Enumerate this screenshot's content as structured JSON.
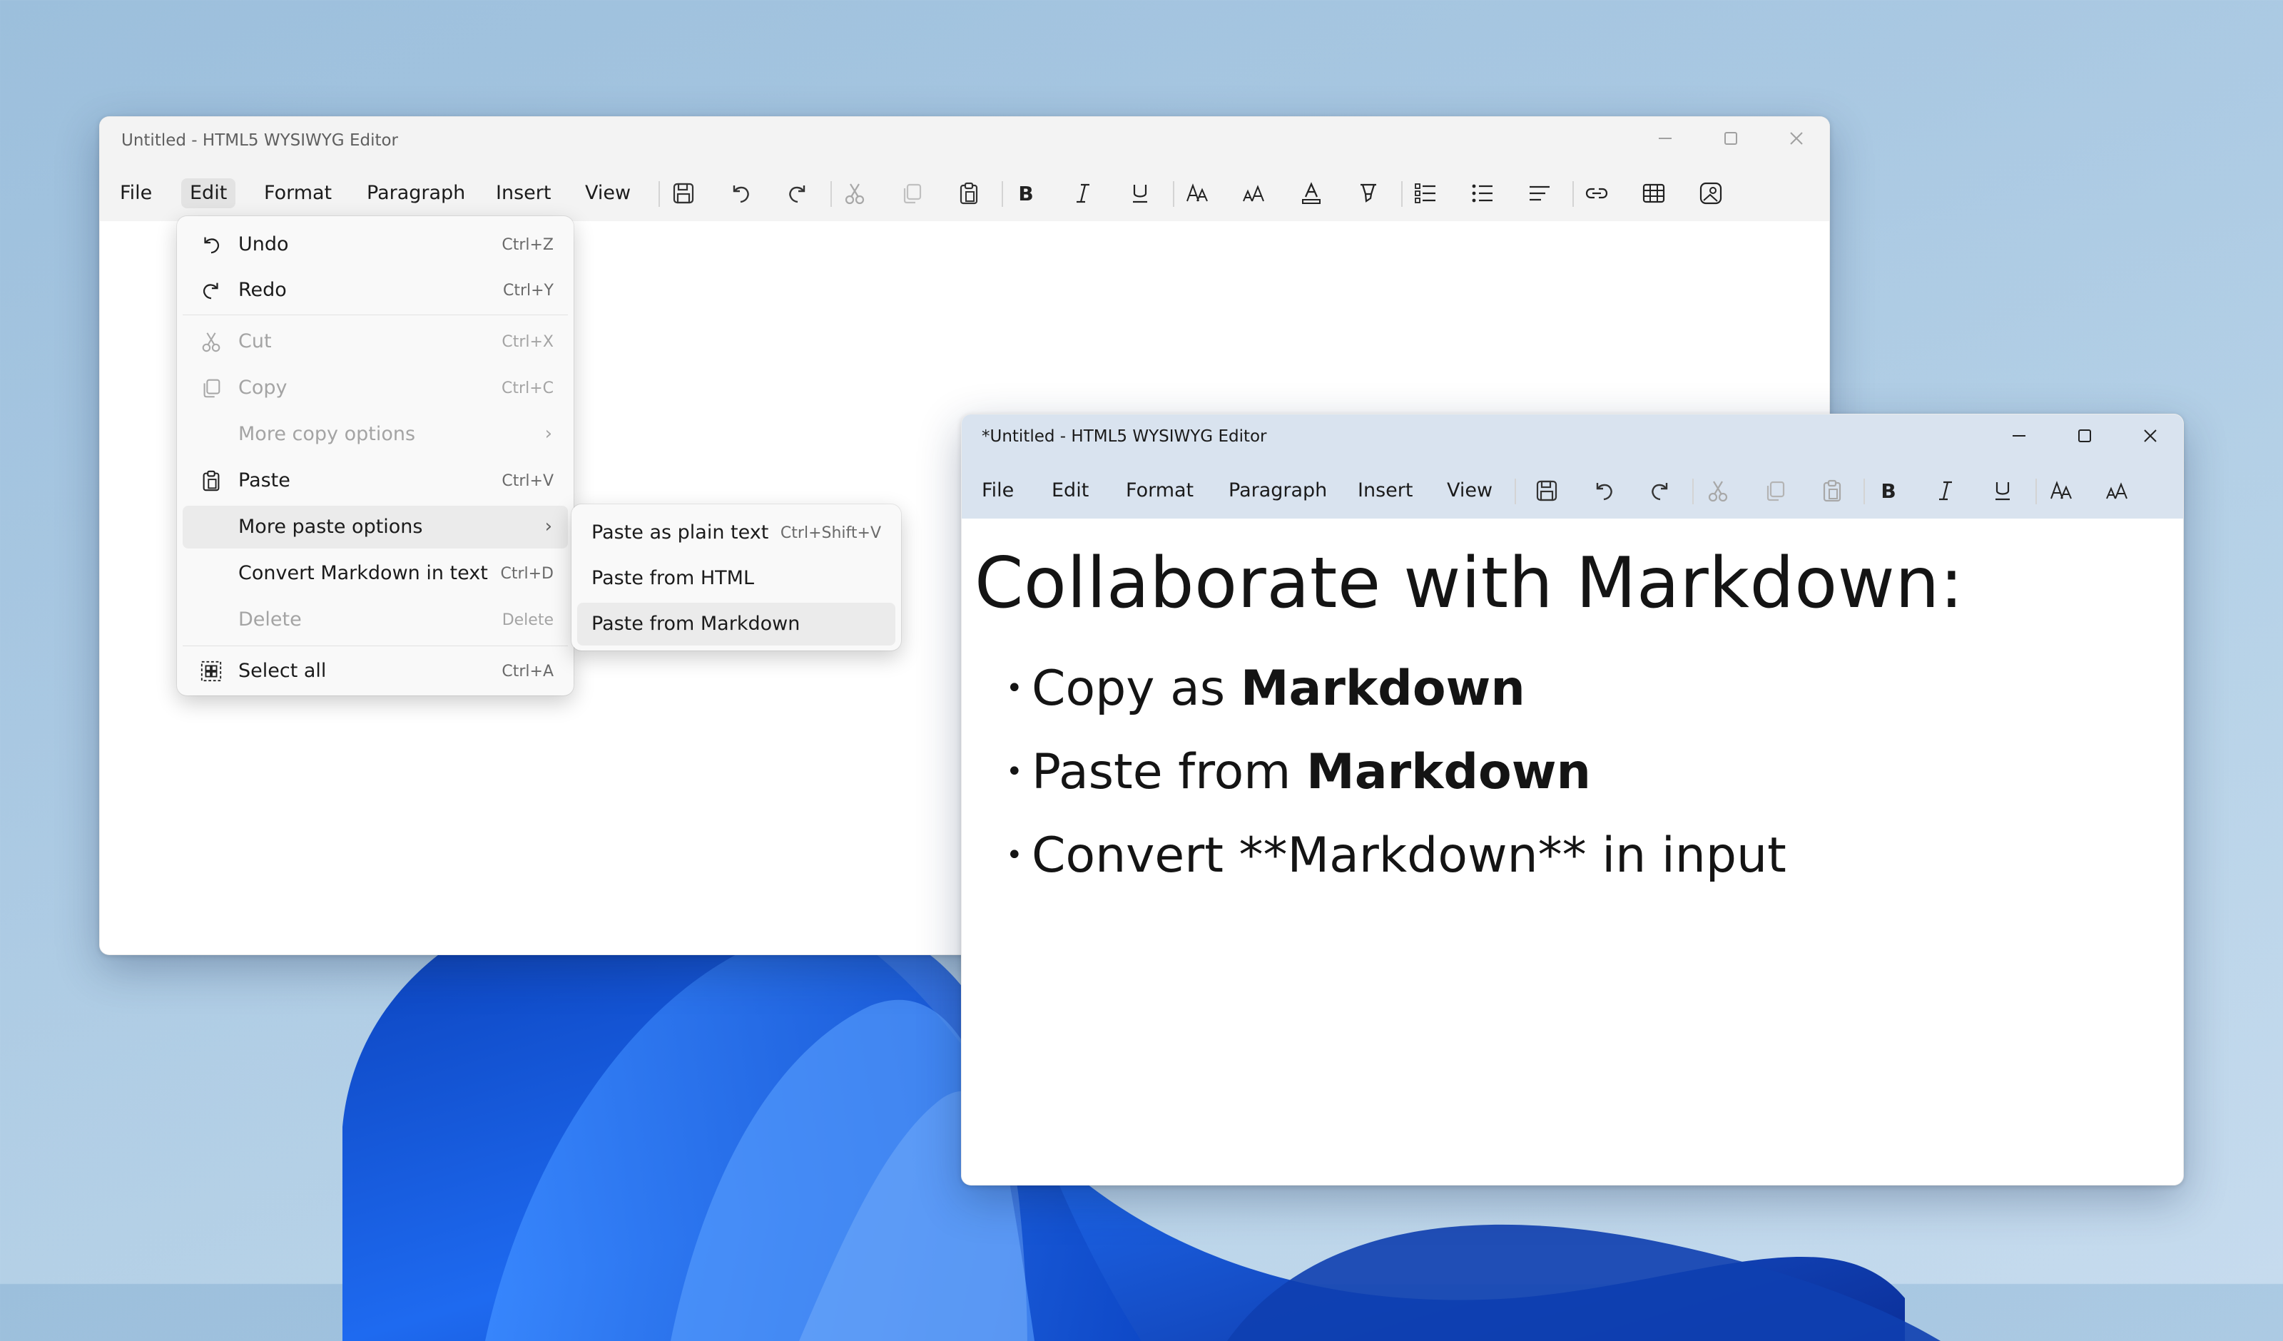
{
  "back_window": {
    "title": "Untitled - HTML5 WYSIWYG Editor",
    "menus": [
      "File",
      "Edit",
      "Format",
      "Paragraph",
      "Insert",
      "View"
    ],
    "active_menu": "Edit"
  },
  "front_window": {
    "title": "*Untitled - HTML5 WYSIWYG Editor",
    "menus": [
      "File",
      "Edit",
      "Format",
      "Paragraph",
      "Insert",
      "View"
    ],
    "document": {
      "heading": "Collaborate with Markdown:",
      "items": [
        {
          "prefix": "Copy as ",
          "bold": "Markdown",
          "suffix": ""
        },
        {
          "prefix": "Paste from ",
          "bold": "Markdown",
          "suffix": ""
        },
        {
          "prefix": "Convert **Markdown** in input",
          "bold": "",
          "suffix": ""
        }
      ]
    }
  },
  "edit_menu": {
    "items": [
      {
        "label": "Undo",
        "shortcut": "Ctrl+Z",
        "icon": "undo-icon",
        "disabled": false
      },
      {
        "label": "Redo",
        "shortcut": "Ctrl+Y",
        "icon": "redo-icon",
        "disabled": false
      },
      {
        "label": "Cut",
        "shortcut": "Ctrl+X",
        "icon": "cut-icon",
        "disabled": true
      },
      {
        "label": "Copy",
        "shortcut": "Ctrl+C",
        "icon": "copy-icon",
        "disabled": true
      },
      {
        "label": "More copy options",
        "shortcut": "",
        "icon": "",
        "disabled": true,
        "submenu": true
      },
      {
        "label": "Paste",
        "shortcut": "Ctrl+V",
        "icon": "paste-icon",
        "disabled": false
      },
      {
        "label": "More paste options",
        "shortcut": "",
        "icon": "",
        "disabled": false,
        "submenu": true,
        "hover": true
      },
      {
        "label": "Convert Markdown in text",
        "shortcut": "Ctrl+D",
        "icon": "",
        "disabled": false
      },
      {
        "label": "Delete",
        "shortcut": "Delete",
        "icon": "",
        "disabled": true
      },
      {
        "label": "Select all",
        "shortcut": "Ctrl+A",
        "icon": "select-all-icon",
        "disabled": false
      }
    ],
    "submenu_arrow": "›"
  },
  "paste_submenu": {
    "items": [
      {
        "label": "Paste as plain text",
        "shortcut": "Ctrl+Shift+V",
        "hover": false
      },
      {
        "label": "Paste from HTML",
        "shortcut": "",
        "hover": false
      },
      {
        "label": "Paste from Markdown",
        "shortcut": "",
        "hover": true
      }
    ]
  },
  "colors": {
    "wallpaper_blue": "#1a5fe0",
    "front_titlebar": "#d9e3ef",
    "back_titlebar": "#f3f3f3"
  }
}
